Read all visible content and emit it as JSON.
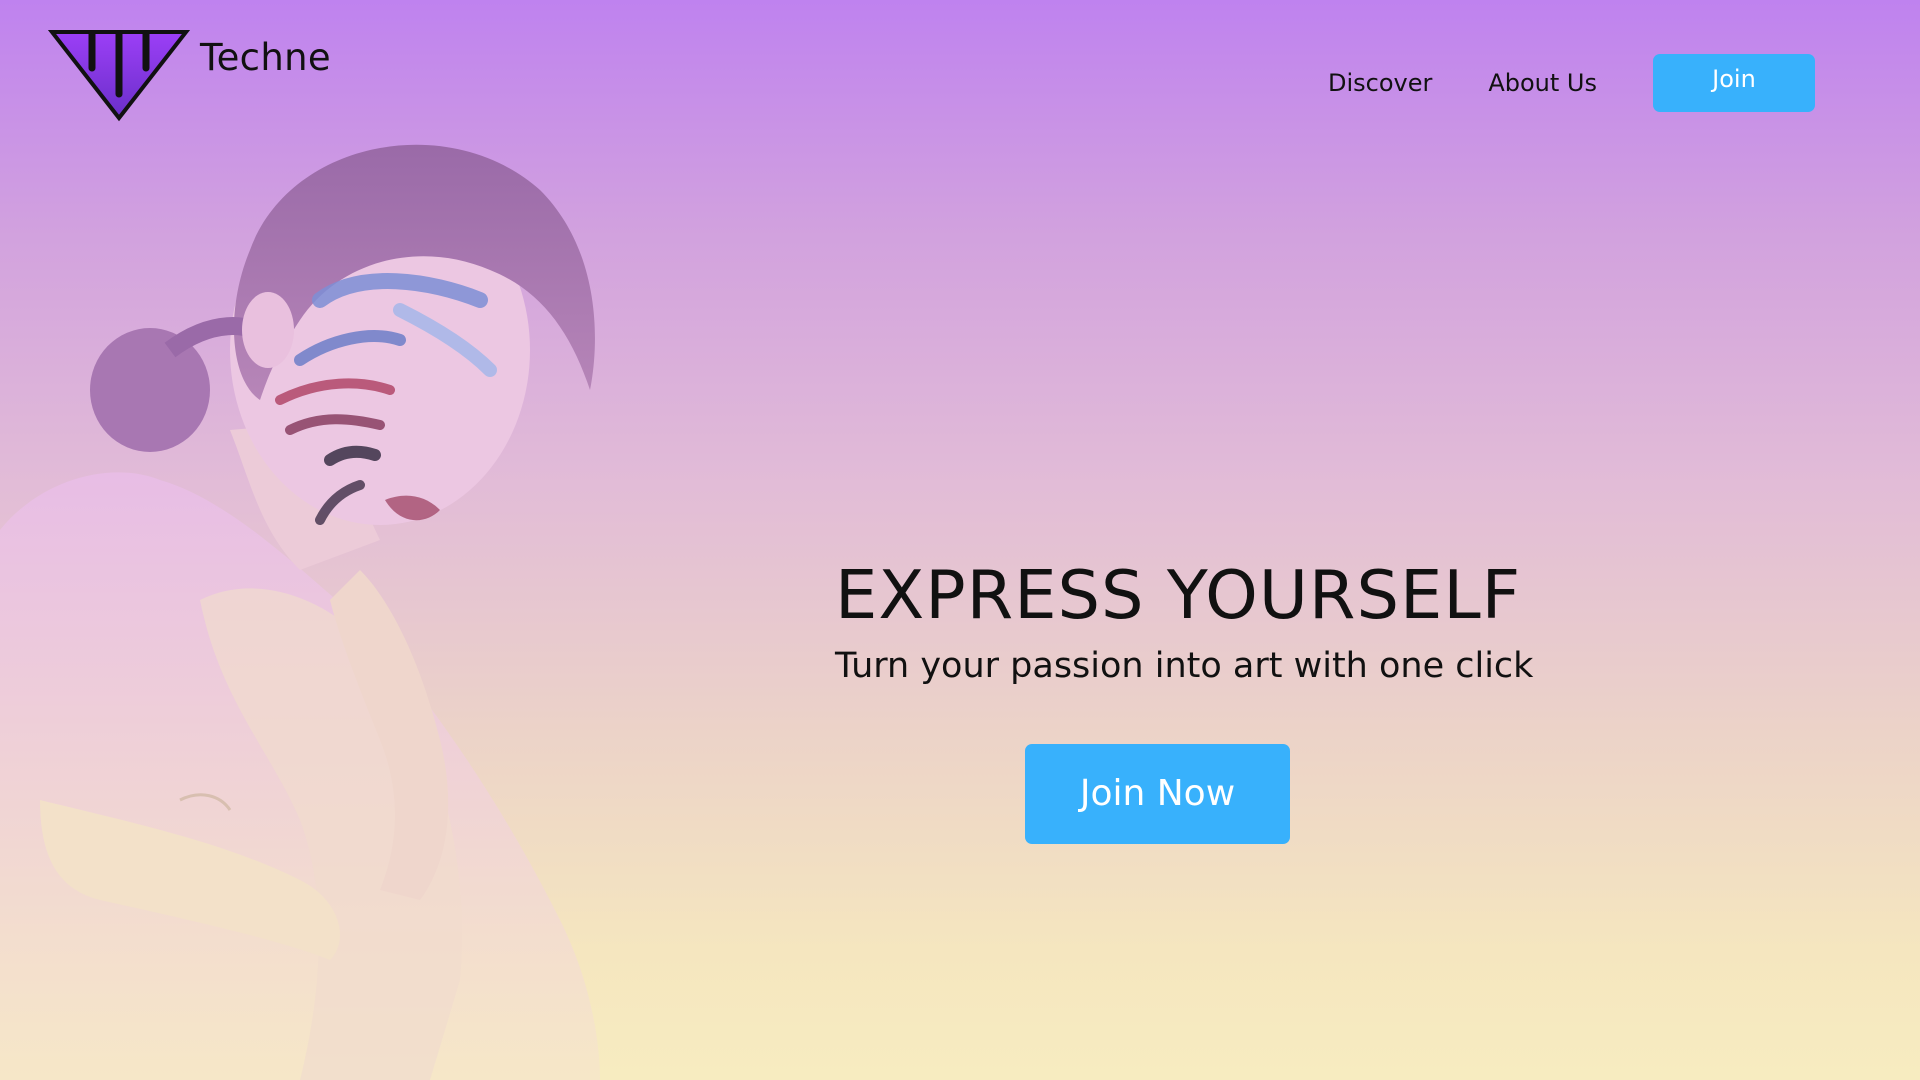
{
  "brand": {
    "name": "Techne"
  },
  "nav": {
    "discover_label": "Discover",
    "about_label": "About Us",
    "join_label": "Join"
  },
  "hero": {
    "title": "EXPRESS YOURSELF",
    "subtitle": "Turn your passion into art with one click",
    "cta_label": "Join Now"
  },
  "colors": {
    "accent": "#38b1fc",
    "gradient_top": "#bf82ef",
    "gradient_bottom": "#f7ecc0",
    "logo_fill": "#8c3cf0"
  }
}
